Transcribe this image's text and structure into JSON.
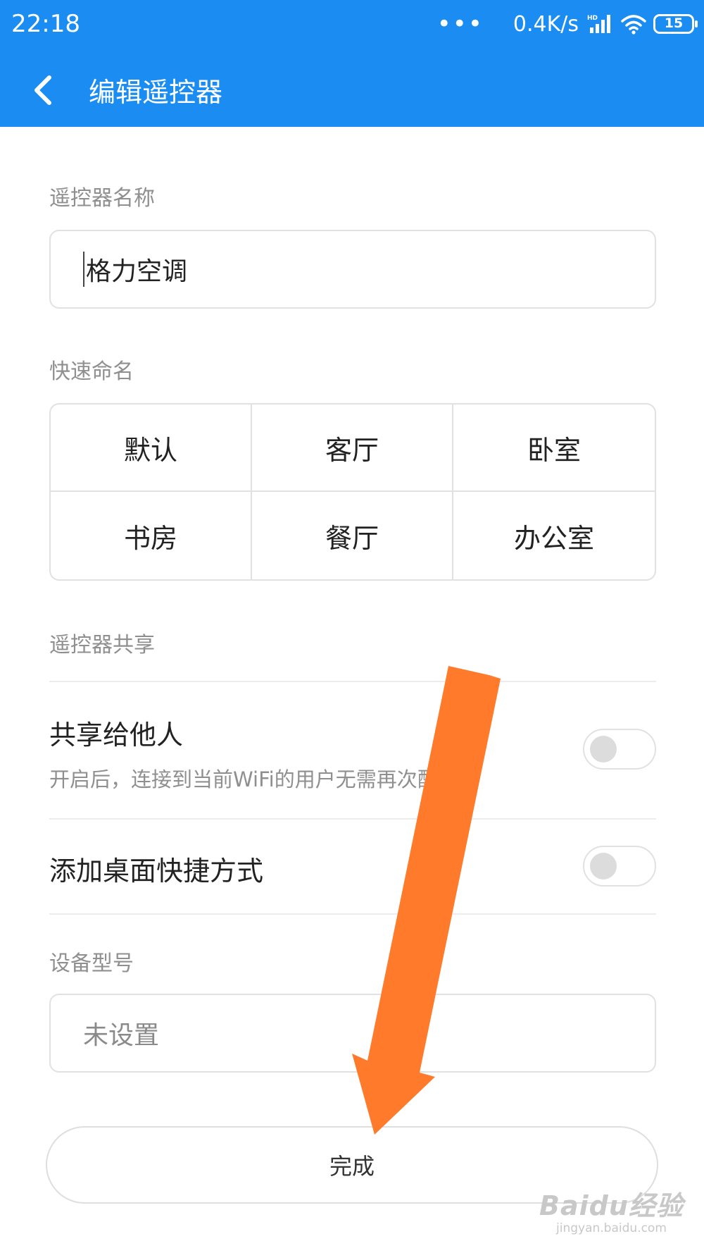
{
  "status_bar": {
    "time": "22:18",
    "dots": "•••",
    "speed": "0.4K/s",
    "network": "HD",
    "battery": "15"
  },
  "header": {
    "title": "编辑遥控器",
    "back_icon": "back-arrow-icon",
    "background": "#1a8cf2"
  },
  "name_section": {
    "label": "遥控器名称",
    "value": "格力空调"
  },
  "quick_name": {
    "label": "快速命名",
    "options": [
      "默认",
      "客厅",
      "卧室",
      "书房",
      "餐厅",
      "办公室"
    ]
  },
  "share_section": {
    "label": "遥控器共享",
    "share_title": "共享给他人",
    "share_desc": "开启后，连接到当前WiFi的用户无需再次配对",
    "share_enabled": false,
    "shortcut_title": "添加桌面快捷方式",
    "shortcut_enabled": false
  },
  "model_section": {
    "label": "设备型号",
    "placeholder": "未设置"
  },
  "done_button": {
    "label": "完成"
  },
  "annotation": {
    "color": "#ff7a2a"
  },
  "watermark": {
    "logo": "Baidu经验",
    "url": "jingyan.baidu.com"
  }
}
